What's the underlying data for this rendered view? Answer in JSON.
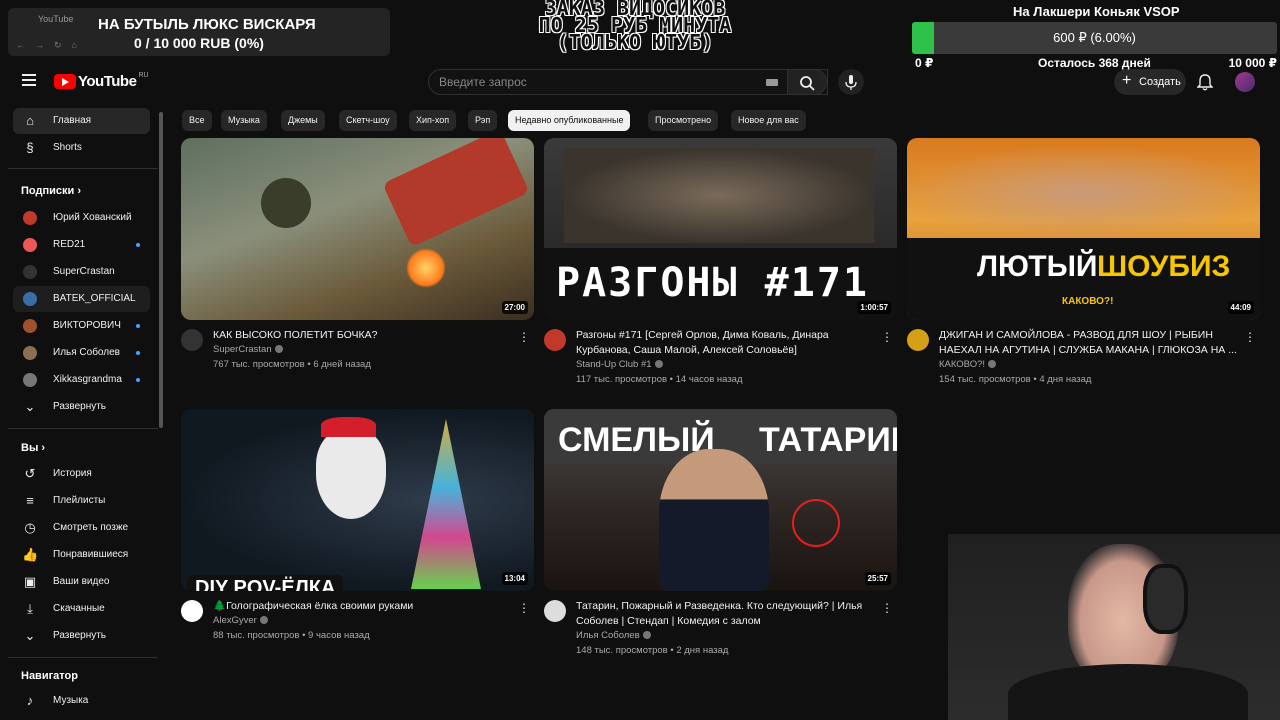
{
  "overlay": {
    "donation_title": "НА БУТЫЛЬ ЛЮКС ВИСКАРЯ",
    "donation_progress": "0 / 10 000 RUB (0%)",
    "browser_tab": "YouTube",
    "order_line1": "ЗАКАЗ ВИДОСИКОВ",
    "order_line2": "ПО 25 РУБ МИНУТА",
    "order_line3": "(ТОЛЬКО ЮТУБ)",
    "goal_title": "На Лакшери Коньяк VSOP",
    "goal_bar_text": "600 ₽ (6.00%)",
    "goal_fraction": 0.06,
    "goal_min": "0 ₽",
    "goal_remaining": "Осталось 368 дней",
    "goal_max": "10 000 ₽",
    "colors": {
      "goal_fill": "#2ec24a",
      "goal_track": "#3a3a3a"
    }
  },
  "masthead": {
    "logo_text": "YouTube",
    "logo_region": "RU",
    "search_placeholder": "Введите запрос",
    "create_label": "Создать"
  },
  "sidebar": {
    "main": [
      {
        "label": "Главная",
        "icon": "home-icon"
      },
      {
        "label": "Shorts",
        "icon": "shorts-icon"
      }
    ],
    "subs_header": "Подписки",
    "subs": [
      {
        "label": "Юрий Хованский"
      },
      {
        "label": "RED21"
      },
      {
        "label": "SuperCrastan"
      },
      {
        "label": "BATEK_OFFICIAL"
      },
      {
        "label": "ВИКТОРОВИЧ"
      },
      {
        "label": "Илья Соболев"
      },
      {
        "label": "Xikkasgrandma"
      },
      {
        "label": "Развернуть"
      }
    ],
    "you_header": "Вы",
    "you": [
      {
        "label": "История"
      },
      {
        "label": "Плейлисты"
      },
      {
        "label": "Смотреть позже"
      },
      {
        "label": "Понравившиеся"
      },
      {
        "label": "Ваши видео"
      },
      {
        "label": "Скачанные"
      },
      {
        "label": "Развернуть"
      }
    ],
    "nav_header": "Навигатор",
    "nav_first": "Музыка"
  },
  "chips": [
    "Все",
    "Музыка",
    "Джемы",
    "Скетч-шоу",
    "Хип-хоп",
    "Рэп",
    "Недавно опубликованные",
    "Просмотрено",
    "Новое для вас"
  ],
  "videos": [
    {
      "title": "КАК ВЫСОКО ПОЛЕТИТ БОЧКА?",
      "channel": "SuperCrastan",
      "meta": "767 тыс. просмотров • 6 дней назад",
      "duration": "27:00"
    },
    {
      "title": "Разгоны #171  [Сергей Орлов, Дима Коваль, Динара Курбанова, Саша Малой, Алексей Соловьёв]",
      "channel": "Stand-Up Club #1",
      "meta": "117 тыс. просмотров • 14 часов назад",
      "duration": "1:00:57",
      "thumb_text": "РАЗГОНЫ #171"
    },
    {
      "title": "ДЖИГАН И САМОЙЛОВА - РАЗВОД ДЛЯ ШОУ | РЫБИН НАЕХАЛ НА АГУТИНА | СЛУЖБА МАКАНА | ГЛЮКОЗА НА ...",
      "channel": "КАКОВО?!",
      "meta": "154 тыс. просмотров • 4 дня назад",
      "duration": "44:09",
      "thumb_text_1": "ЛЮТЫЙ",
      "thumb_text_2": "ШОУБИЗ",
      "thumb_text_3": "КАКОВО?!"
    },
    {
      "title": "🌲Голографическая ёлка своими руками",
      "channel": "AlexGyver",
      "meta": "88 тыс. просмотров • 9 часов назад",
      "duration": "13:04",
      "thumb_text": "DIY POV-ЁЛКА"
    },
    {
      "title": "Татарин, Пожарный и Разведенка. Кто следующий? | Илья Соболев | Стендап | Комедия с залом",
      "channel": "Илья Соболев",
      "meta": "148 тыс. просмотров • 2 дня назад",
      "duration": "25:57",
      "thumb_text_1": "СМЕЛЫЙ",
      "thumb_text_2": "ТАТАРИН"
    }
  ]
}
